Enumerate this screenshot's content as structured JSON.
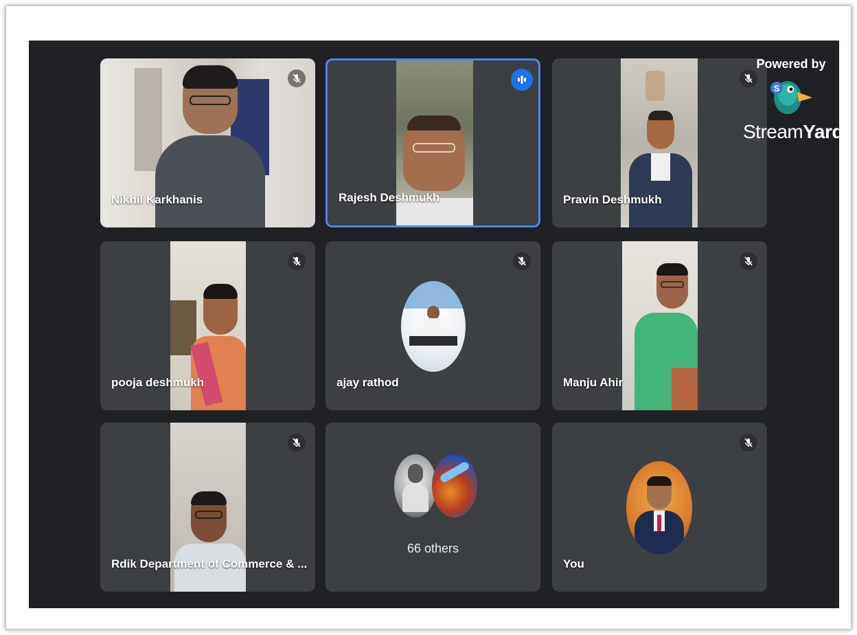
{
  "branding": {
    "powered_by": "Powered by",
    "logo_text_light": "Stream",
    "logo_text_bold": "Yard"
  },
  "colors": {
    "background": "#202124",
    "tile": "#3c4043",
    "active_speaker_border": "#4f86e8",
    "speaking_indicator": "#1a73e8"
  },
  "participants": [
    {
      "name": "Nikhil Karkhanis",
      "status": "muted"
    },
    {
      "name": "Rajesh Deshmukh",
      "status": "speaking"
    },
    {
      "name": "Pravin Deshmukh",
      "status": "muted"
    },
    {
      "name": "pooja deshmukh",
      "status": "muted"
    },
    {
      "name": "ajay rathod",
      "status": "muted"
    },
    {
      "name": "Manju Ahir",
      "status": "muted"
    },
    {
      "name": "Rdik Department of Commerce & ...",
      "status": "muted"
    },
    {
      "name": "66 others",
      "status": "group"
    },
    {
      "name": "You",
      "status": "muted"
    }
  ]
}
